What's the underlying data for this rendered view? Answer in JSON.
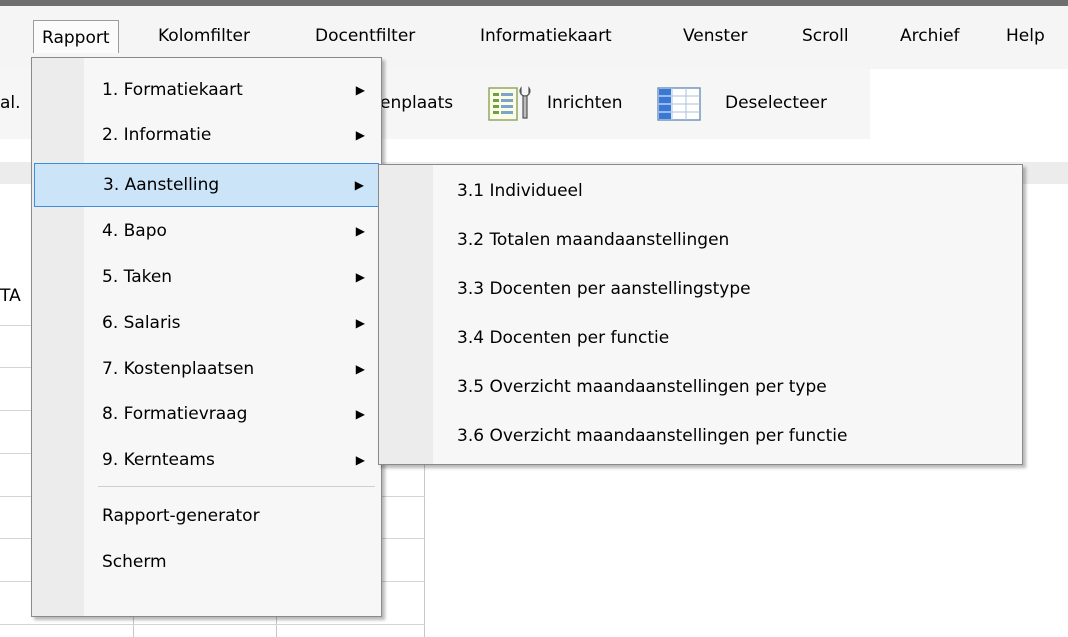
{
  "menubar": {
    "items": [
      "Rapport",
      "Kolomfilter",
      "Docentfilter",
      "Informatiekaart",
      "Venster",
      "Scroll",
      "Archief",
      "Help"
    ]
  },
  "toolbar": {
    "partial_left": "al.",
    "kostenplaats_partial": "enplaats",
    "inrichten": "Inrichten",
    "deselecteer": "Deselecteer"
  },
  "grid": {
    "header_partial": "TA"
  },
  "rapport_menu": {
    "items": [
      {
        "label": "1. Formatiekaart",
        "has_submenu": true
      },
      {
        "label": "2. Informatie",
        "has_submenu": true
      },
      {
        "label": "3. Aanstelling",
        "has_submenu": true,
        "highlighted": true
      },
      {
        "label": "4. Bapo",
        "has_submenu": true
      },
      {
        "label": "5. Taken",
        "has_submenu": true
      },
      {
        "label": "6. Salaris",
        "has_submenu": true
      },
      {
        "label": "7. Kostenplaatsen",
        "has_submenu": true
      },
      {
        "label": "8. Formatievraag",
        "has_submenu": true
      },
      {
        "label": "9. Kernteams",
        "has_submenu": true
      },
      {
        "label": "Rapport-generator",
        "has_submenu": false
      },
      {
        "label": "Scherm",
        "has_submenu": false
      }
    ]
  },
  "aanstelling_submenu": {
    "items": [
      "3.1 Individueel",
      "3.2 Totalen maandaanstellingen",
      "3.3 Docenten per aanstellingstype",
      "3.4 Docenten per functie",
      "3.5 Overzicht maandaanstellingen per type",
      "3.6 Overzicht maandaanstellingen per functie"
    ]
  },
  "icons": {
    "submenu_arrow": "▶",
    "inrichten_icon": "wrench-list-icon",
    "deselecteer_icon": "grid-deselect-icon"
  }
}
